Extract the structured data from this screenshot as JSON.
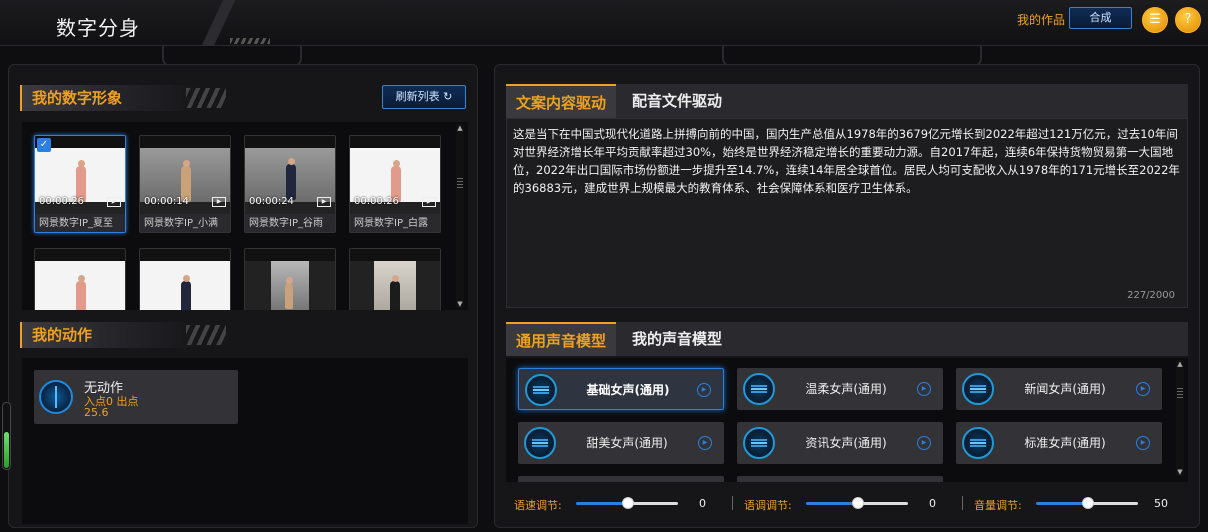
{
  "header": {
    "title": "数字分身",
    "my_works": "我的作品",
    "synth_label": "合成",
    "list_icon": "list-icon",
    "help_icon": "help-icon"
  },
  "avatars": {
    "section_title": "我的数字形象",
    "refresh_label": "刷新列表 ↻",
    "items": [
      {
        "name": "网景数字IP_夏至",
        "duration": "00:00:26",
        "selected": true
      },
      {
        "name": "网景数字IP_小满",
        "duration": "00:00:14",
        "selected": false
      },
      {
        "name": "网景数字IP_谷雨",
        "duration": "00:00:24",
        "selected": false
      },
      {
        "name": "网景数字IP_白露",
        "duration": "00:00:26",
        "selected": false
      },
      {
        "name": "",
        "duration": "",
        "selected": false
      },
      {
        "name": "",
        "duration": "",
        "selected": false
      },
      {
        "name": "",
        "duration": "",
        "selected": false
      },
      {
        "name": "",
        "duration": "",
        "selected": false
      }
    ]
  },
  "actions": {
    "section_title": "我的动作",
    "items": [
      {
        "name": "无动作",
        "inout": "入点0   出点",
        "time": "25.6"
      }
    ]
  },
  "script_tabs": {
    "tabs": [
      {
        "label": "文案内容驱动",
        "active": true
      },
      {
        "label": "配音文件驱动",
        "active": false
      }
    ],
    "content": "这是当下在中国式现代化道路上拼搏向前的中国，国内生产总值从1978年的3679亿元增长到2022年超过121万亿元，过去10年间对世界经济增长年平均贡献率超过30%，始终是世界经济稳定增长的重要动力源。自2017年起，连续6年保持货物贸易第一大国地位，2022年出口国际市场份额进一步提升至14.7%，连续14年居全球首位。居民人均可支配收入从1978年的171元增长至2022年的36883元，建成世界上规模最大的教育体系、社会保障体系和医疗卫生体系。",
    "counter": "227/2000"
  },
  "voice_tabs": {
    "tabs": [
      {
        "label": "通用声音模型",
        "active": true
      },
      {
        "label": "我的声音模型",
        "active": false
      }
    ],
    "items": [
      {
        "name": "基础女声(通用)",
        "selected": true
      },
      {
        "name": "温柔女声(通用)",
        "selected": false
      },
      {
        "name": "新闻女声(通用)",
        "selected": false
      },
      {
        "name": "甜美女声(通用)",
        "selected": false
      },
      {
        "name": "资讯女声(通用)",
        "selected": false
      },
      {
        "name": "标准女声(通用)",
        "selected": false
      }
    ]
  },
  "sliders": [
    {
      "label": "语速调节:",
      "value": "0",
      "fraction": 0.5
    },
    {
      "label": "语调调节:",
      "value": "0",
      "fraction": 0.5
    },
    {
      "label": "音量调节:",
      "value": "50",
      "fraction": 0.5
    }
  ]
}
